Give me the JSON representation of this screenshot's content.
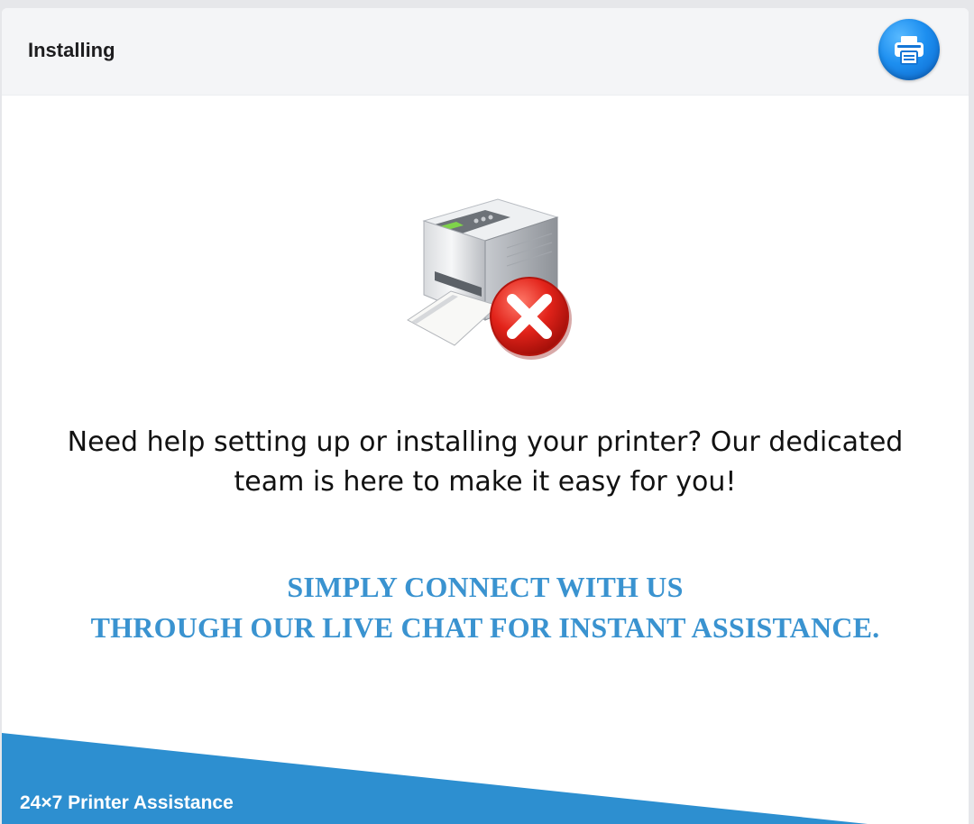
{
  "header": {
    "title": "Installing",
    "action_icon": "printer-icon"
  },
  "main": {
    "illustration_icon": "printer-error-icon",
    "message_line1": "Need help setting up or installing your printer? Our dedicated",
    "message_line2": "team is here to make it easy for you!",
    "cta_line1": "SIMPLY CONNECT WITH US",
    "cta_line2": "THROUGH OUR LIVE CHAT FOR INSTANT ASSISTANCE."
  },
  "footer": {
    "label": "24×7 Printer Assistance"
  },
  "colors": {
    "accent": "#3a93d0",
    "band": "#2d8fd0",
    "header_bg": "#f4f5f7",
    "error_red": "#e2231a"
  }
}
